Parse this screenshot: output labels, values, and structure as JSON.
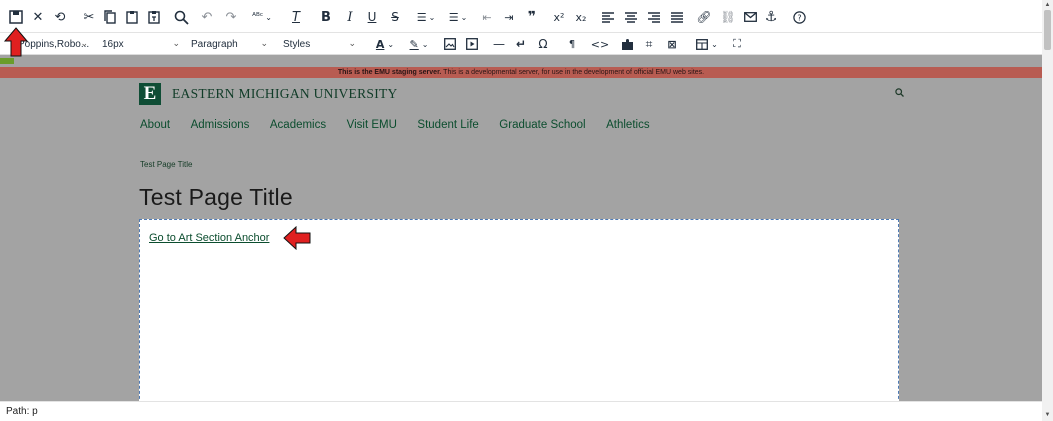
{
  "toolbar": {
    "row1": [
      "save",
      "cancel",
      "restore-draft",
      "cut",
      "copy",
      "paste",
      "paste-text",
      "find-replace",
      "undo",
      "redo",
      "spellcheck",
      "clear-formatting",
      "bold",
      "italic",
      "underline",
      "strikethrough",
      "bullet-list",
      "numbered-list",
      "outdent",
      "indent",
      "blockquote",
      "superscript",
      "subscript",
      "align-left",
      "align-center",
      "align-right",
      "justify",
      "link",
      "unlink",
      "email",
      "anchor",
      "help"
    ],
    "font_family": "Poppins,Robo...",
    "font_size": "16px",
    "block_format": "Paragraph",
    "styles": "Styles"
  },
  "banner": {
    "bold": "This is the EMU staging server.",
    "rest": " This is a developmental server, for use in the development of official EMU web sites."
  },
  "site": {
    "logo_letter": "E",
    "logo_name": "EASTERN MICHIGAN UNIVERSITY",
    "nav": [
      "About",
      "Admissions",
      "Academics",
      "Visit EMU",
      "Student Life",
      "Graduate School",
      "Athletics"
    ],
    "breadcrumb": "Test Page Title",
    "title": "Test Page Title"
  },
  "content": {
    "link_text": "Go to Art Section Anchor"
  },
  "status": {
    "path": "Path: p"
  },
  "colors": {
    "brand_green": "#0f4d35",
    "banner_red": "#b85c52",
    "arrow_red": "#e02020",
    "editor_gray": "#a3a3a3"
  }
}
